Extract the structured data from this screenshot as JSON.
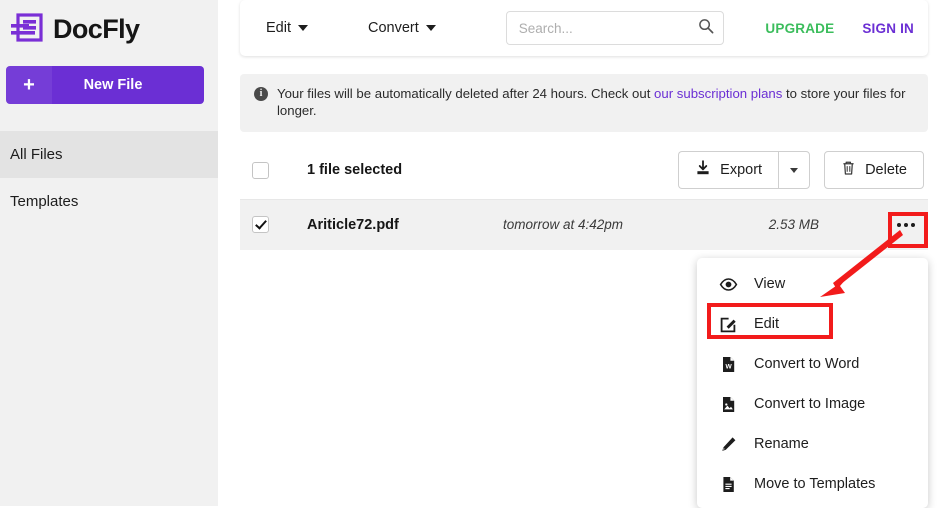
{
  "brand": {
    "name": "DocFly",
    "logo_icon": "docfly-logo-icon"
  },
  "colors": {
    "purple": "#6b2fd4",
    "green": "#3bbd5c",
    "sidebar_bg": "#f1f1f1",
    "annotation_red": "#f21b1b"
  },
  "sidebar": {
    "new_file_label": "New File",
    "new_file_plus": "+",
    "items": [
      {
        "label": "All Files",
        "active": true
      },
      {
        "label": "Templates",
        "active": false
      }
    ]
  },
  "topbar": {
    "edit_label": "Edit",
    "convert_label": "Convert",
    "search": {
      "value": "",
      "placeholder": "Search..."
    },
    "upgrade_label": "UPGRADE",
    "signin_label": "SIGN IN"
  },
  "banner": {
    "icon": "info-icon",
    "text_before": "Your files will be automatically deleted after 24 hours. Check out",
    "link_text": "our subscription plans",
    "text_after": "to store your files for longer."
  },
  "selection_bar": {
    "checkbox_checked": false,
    "label": "1 file selected",
    "export_label": "Export",
    "export_icon": "download-icon",
    "export_dropdown_icon": "chevron-down-icon",
    "delete_label": "Delete",
    "delete_icon": "trash-icon"
  },
  "file_list": {
    "rows": [
      {
        "checked": true,
        "name": "Ariticle72.pdf",
        "modified": "tomorrow at 4:42pm",
        "size": "2.53 MB",
        "more_icon": "ellipsis-icon"
      }
    ]
  },
  "context_menu": {
    "items": [
      {
        "label": "View",
        "icon": "eye-icon"
      },
      {
        "label": "Edit",
        "icon": "edit-square-icon",
        "highlighted": true
      },
      {
        "label": "Convert to Word",
        "icon": "word-file-icon"
      },
      {
        "label": "Convert to Image",
        "icon": "image-file-icon"
      },
      {
        "label": "Rename",
        "icon": "pencil-icon"
      },
      {
        "label": "Move to Templates",
        "icon": "file-icon"
      }
    ]
  },
  "annotations": {
    "arrow": {
      "name": "red-arrow-pointer"
    },
    "boxes": [
      {
        "name": "highlight-box-ellipsis"
      },
      {
        "name": "highlight-box-edit"
      }
    ]
  }
}
